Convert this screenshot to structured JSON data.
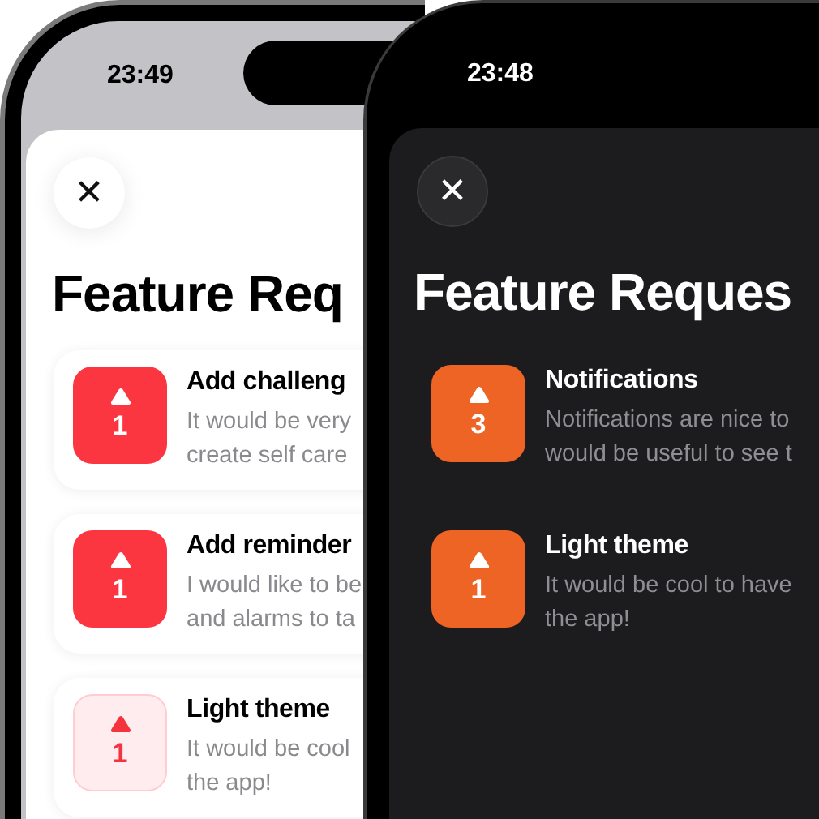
{
  "phones": [
    {
      "kind": "light",
      "time": "23:49",
      "close_label": "✕",
      "title": "Feature Req",
      "requests": [
        {
          "votes": "1",
          "voted": true,
          "title": "Add challeng",
          "description_lines": [
            "It would be very",
            "create self care"
          ]
        },
        {
          "votes": "1",
          "voted": true,
          "title": "Add reminder",
          "description_lines": [
            "I would like to be",
            "and alarms to ta"
          ]
        },
        {
          "votes": "1",
          "voted": false,
          "title": "Light theme",
          "description_lines": [
            "It would be cool",
            "the app!"
          ]
        }
      ]
    },
    {
      "kind": "dark",
      "time": "23:48",
      "close_label": "✕",
      "title": "Feature Reques",
      "requests": [
        {
          "votes": "3",
          "voted": true,
          "title": "Notifications",
          "description_lines": [
            "Notifications are nice to",
            "would be useful to see t"
          ]
        },
        {
          "votes": "1",
          "voted": true,
          "title": "Light theme",
          "description_lines": [
            "It would be cool to have",
            "the app!"
          ]
        }
      ]
    }
  ]
}
